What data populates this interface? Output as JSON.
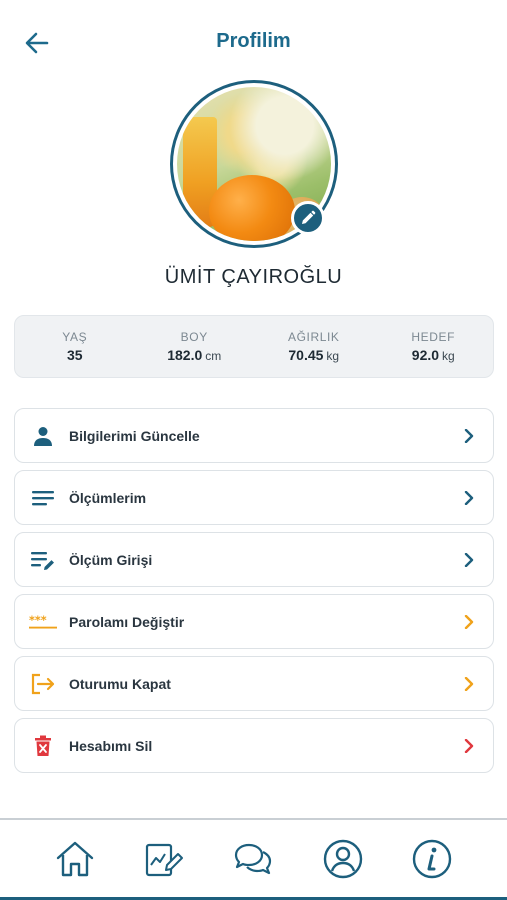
{
  "header": {
    "title": "Profilim",
    "back_icon": "arrow-left-icon"
  },
  "profile": {
    "name": "ÜMİT ÇAYIROĞLU",
    "edit_icon": "pencil-icon"
  },
  "stats": [
    {
      "label": "YAŞ",
      "value": "35",
      "unit": ""
    },
    {
      "label": "BOY",
      "value": "182.0",
      "unit": "cm"
    },
    {
      "label": "AĞIRLIK",
      "value": "70.45",
      "unit": "kg"
    },
    {
      "label": "HEDEF",
      "value": "92.0",
      "unit": "kg"
    }
  ],
  "menu": [
    {
      "label": "Bilgilerimi Güncelle",
      "icon": "person-icon",
      "color": "#1d5f7d"
    },
    {
      "label": "Ölçümlerim",
      "icon": "list-icon",
      "color": "#1d5f7d"
    },
    {
      "label": "Ölçüm Girişi",
      "icon": "list-edit-icon",
      "color": "#1d5f7d"
    },
    {
      "label": "Parolamı Değiştir",
      "icon": "password-icon",
      "color": "#f0a21b"
    },
    {
      "label": "Oturumu Kapat",
      "icon": "logout-icon",
      "color": "#f0a21b"
    },
    {
      "label": "Hesabımı Sil",
      "icon": "trash-icon",
      "color": "#e0383e"
    }
  ],
  "tabs": [
    {
      "name": "home",
      "icon": "home-icon"
    },
    {
      "name": "notes",
      "icon": "chart-edit-icon"
    },
    {
      "name": "chat",
      "icon": "chat-icon"
    },
    {
      "name": "profile",
      "icon": "user-circle-icon"
    },
    {
      "name": "info",
      "icon": "info-icon"
    }
  ],
  "colors": {
    "primary": "#1d5f7d",
    "accent": "#f0a21b",
    "danger": "#e0383e"
  }
}
